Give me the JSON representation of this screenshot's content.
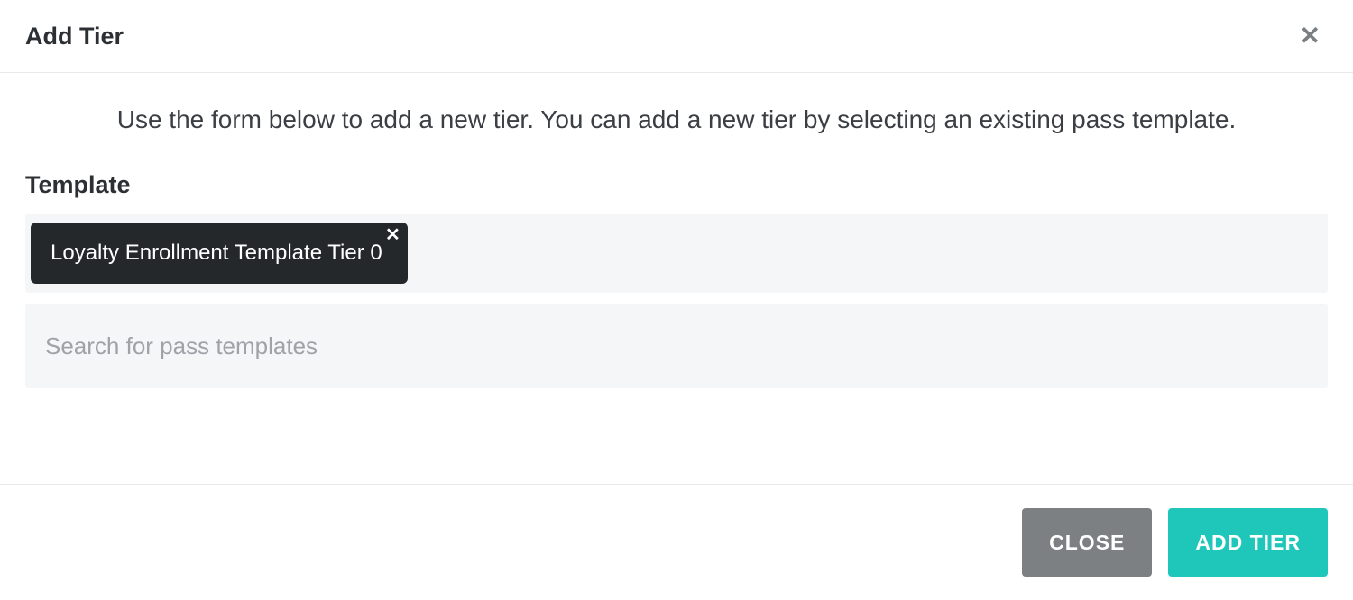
{
  "modal": {
    "title": "Add Tier",
    "close_glyph": "✕",
    "description": "Use the form below to add a new tier. You can add a new tier by selecting an existing pass template."
  },
  "template_section": {
    "label": "Template",
    "selected_chip": "Loyalty Enrollment Template Tier 0",
    "chip_remove_glyph": "✕",
    "search_placeholder": "Search for pass templates"
  },
  "footer": {
    "close_label": "Close",
    "submit_label": "Add Tier"
  },
  "colors": {
    "primary": "#1fc7bb",
    "secondary": "#7c8083",
    "chip_bg": "#24282b"
  }
}
